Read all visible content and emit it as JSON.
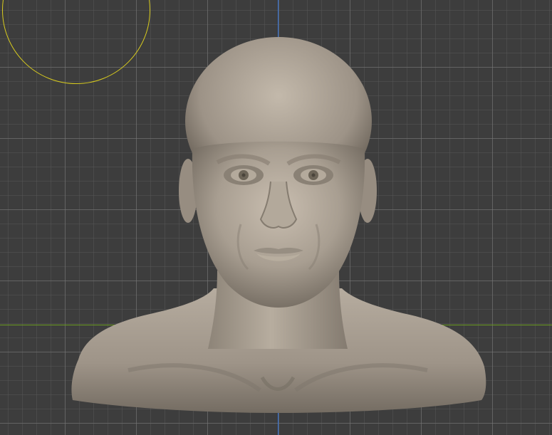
{
  "viewport": {
    "mode": "Sculpt",
    "object": "head-bust-sculpt",
    "grid": true
  },
  "colors": {
    "background": "#3d3d3d",
    "grid_minor": "#4a4a4a",
    "grid_major": "#555555",
    "axis_x": "#6a9a1f",
    "axis_y": "#2f6fd6",
    "brush_cursor": "#d9cc1e",
    "clay": "#a39a8f"
  },
  "icons": {
    "brush": "brush-cursor-circle"
  }
}
